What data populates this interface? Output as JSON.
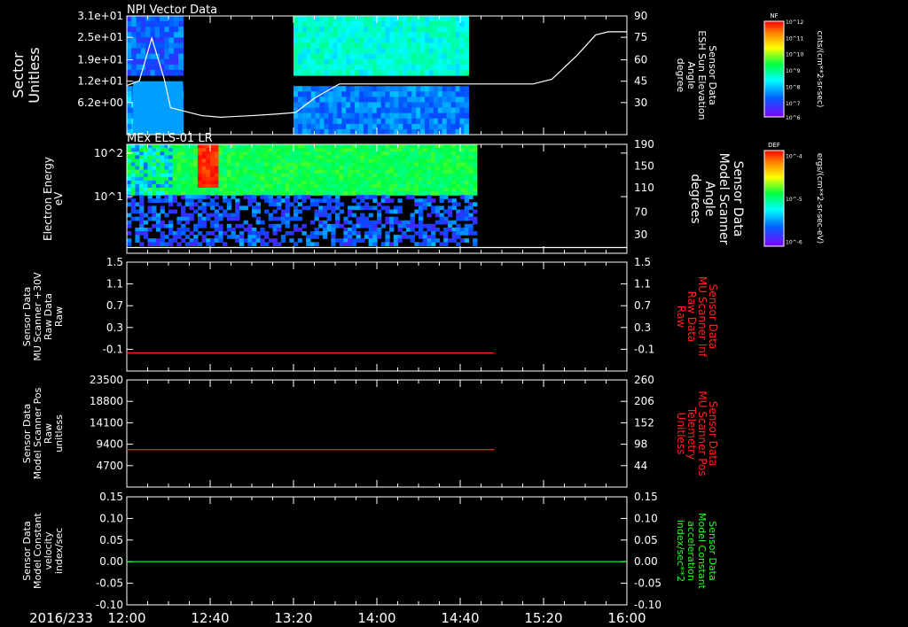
{
  "date_label": "2016/233",
  "time_ticks": [
    "12:00",
    "12:40",
    "13:20",
    "14:00",
    "14:40",
    "15:20",
    "16:00"
  ],
  "colorbars": [
    {
      "title": "NF",
      "unit": "cnts/(cm**2-sr-sec)",
      "tick_labels": [
        "10^12",
        "10^11",
        "10^10",
        "10^9",
        "10^8",
        "10^7",
        "10^6"
      ]
    },
    {
      "title": "DEF",
      "unit": "ergs/(cm**2-sr-sec-eV)",
      "tick_labels": [
        "10^-4",
        "10^-5",
        "10^-6"
      ]
    }
  ],
  "chart_data": [
    {
      "type": "heatmap",
      "title": "NPI Vector Data",
      "ylabel": [
        "Sector",
        "Unitless"
      ],
      "y_ticks": [
        "3.1e+01",
        "2.5e+01",
        "1.9e+01",
        "1.2e+01",
        "6.2e+00"
      ],
      "right_label": [
        "Sensor Data",
        "ESH Sun Elevation",
        "Angle",
        "degree"
      ],
      "right_ticks": [
        "90",
        "75",
        "60",
        "45",
        "30"
      ],
      "right_color": "#ffffff",
      "xlim": [
        "12:00",
        "16:00"
      ],
      "data_coverage": [
        [
          "12:00",
          "12:27"
        ],
        [
          "13:20",
          "14:44"
        ]
      ],
      "overlay_series": {
        "color": "#ffffff",
        "x_hours": [
          12.0,
          12.1,
          12.2,
          12.3,
          12.35,
          12.45,
          12.6,
          12.75,
          13.0,
          13.2,
          13.35,
          13.5,
          13.7,
          14.0,
          14.5,
          15.0,
          15.25,
          15.4,
          15.6,
          15.75,
          15.85,
          16.0
        ],
        "values": [
          46,
          49,
          76,
          50,
          32,
          30,
          27,
          26,
          27,
          28,
          29,
          38,
          47,
          47,
          47,
          47,
          47,
          50,
          65,
          78,
          80,
          80
        ]
      }
    },
    {
      "type": "heatmap",
      "title": "MEx ELS-01 LR",
      "ylabel": [
        "Electron Energy",
        "eV"
      ],
      "y_ticks": [
        "10^2",
        "10^1"
      ],
      "right_label": [
        "Sensor Data",
        "Model Scanner",
        "Angle",
        "degrees"
      ],
      "right_ticks": [
        "190",
        "150",
        "110",
        "70",
        "30"
      ],
      "right_color": "#ffffff",
      "xlim": [
        "12:00",
        "16:00"
      ],
      "data_coverage": [
        [
          "12:00",
          "14:48"
        ]
      ],
      "overlay_series": {
        "color": "#ffffff",
        "x_hours": [
          12.0,
          16.0
        ],
        "values": [
          10,
          10
        ]
      }
    },
    {
      "type": "line",
      "ylabel": [
        "Sensor Data",
        "MU Scanner +30V",
        "Raw Data",
        "Raw"
      ],
      "y_ticks": [
        "1.5",
        "1.1",
        "0.7",
        "0.3",
        "-0.1"
      ],
      "ylim": [
        -0.3,
        1.5
      ],
      "right_label": [
        "Sensor Data",
        "MU Scanner Inf",
        "Raw Data",
        "Raw"
      ],
      "right_ticks": [
        "1.5",
        "1.1",
        "0.7",
        "0.3",
        "-0.1"
      ],
      "right_color": "#ff2020",
      "series": [
        {
          "color": "#ff2020",
          "x_hours": [
            12.0,
            14.94
          ],
          "values": [
            0.0,
            0.0
          ]
        }
      ]
    },
    {
      "type": "line",
      "ylabel": [
        "Sensor Data",
        "Model Scanner Pos",
        "Raw",
        "unitless"
      ],
      "y_ticks": [
        "23500",
        "18800",
        "14100",
        "9400",
        "4700"
      ],
      "ylim": [
        0,
        23500
      ],
      "right_label": [
        "Sensor Data",
        "MU Scanner Pos",
        "Telemetry",
        "Unitless"
      ],
      "right_ticks": [
        "260",
        "206",
        "152",
        "98",
        "44"
      ],
      "right_color": "#ff2020",
      "series": [
        {
          "color": "#ff2020",
          "x_hours": [
            12.0,
            14.94
          ],
          "values": [
            8200,
            8200
          ]
        }
      ]
    },
    {
      "type": "line",
      "ylabel": [
        "Sensor Data",
        "Model Constant",
        "velocity",
        "index/sec"
      ],
      "y_ticks": [
        "0.15",
        "0.10",
        "0.05",
        "0.00",
        "-0.05",
        "-0.10"
      ],
      "ylim": [
        -0.1,
        0.15
      ],
      "right_label": [
        "Sensor Data",
        "Model Constant",
        "acceleration",
        "index/sec**2"
      ],
      "right_ticks": [
        "0.15",
        "0.10",
        "0.05",
        "0.00",
        "-0.05",
        "-0.10"
      ],
      "right_color": "#20ff20",
      "series": [
        {
          "color": "#20ff20",
          "x_hours": [
            12.0,
            16.0
          ],
          "values": [
            0.0,
            0.0
          ]
        }
      ]
    }
  ]
}
